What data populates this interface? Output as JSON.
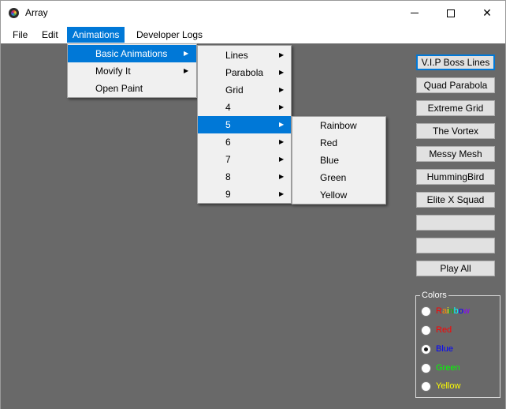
{
  "window": {
    "title": "Array",
    "minimize_icon": "minimize-icon",
    "maximize_icon": "maximize-icon",
    "close_icon": "close-icon",
    "close_glyph": "✕"
  },
  "menubar": {
    "items": [
      {
        "label": "File"
      },
      {
        "label": "Edit"
      },
      {
        "label": "Animations",
        "active": true
      },
      {
        "label": "Developer Logs"
      }
    ]
  },
  "menus": {
    "animations": [
      {
        "label": "Basic Animations",
        "has_submenu": true,
        "highlighted": true
      },
      {
        "label": "Movify It",
        "has_submenu": true
      },
      {
        "label": "Open Paint",
        "has_submenu": false
      }
    ],
    "basic_animations": [
      {
        "label": "Lines",
        "has_submenu": true
      },
      {
        "label": "Parabola",
        "has_submenu": true
      },
      {
        "label": "Grid",
        "has_submenu": true
      },
      {
        "label": "4",
        "has_submenu": true
      },
      {
        "label": "5",
        "has_submenu": true,
        "highlighted": true
      },
      {
        "label": "6",
        "has_submenu": true
      },
      {
        "label": "7",
        "has_submenu": true
      },
      {
        "label": "8",
        "has_submenu": true
      },
      {
        "label": "9",
        "has_submenu": true
      }
    ],
    "submenu_5": [
      {
        "label": "Rainbow"
      },
      {
        "label": "Red"
      },
      {
        "label": "Blue"
      },
      {
        "label": "Green"
      },
      {
        "label": "Yellow"
      }
    ],
    "arrow_glyph": "▶"
  },
  "buttons": [
    {
      "label": "V.I.P Boss Lines",
      "focused": true
    },
    {
      "label": "Quad Parabola"
    },
    {
      "label": "Extreme Grid"
    },
    {
      "label": "The Vortex"
    },
    {
      "label": "Messy Mesh"
    },
    {
      "label": "HummingBird"
    },
    {
      "label": "Elite X Squad"
    },
    {
      "label": ""
    },
    {
      "label": ""
    },
    {
      "label": "Play All"
    }
  ],
  "colors_group": {
    "legend": "Colors",
    "options": [
      {
        "label": "Rainbow",
        "color": "rainbow",
        "checked": false
      },
      {
        "label": "Red",
        "color": "#ff0000",
        "checked": false
      },
      {
        "label": "Blue",
        "color": "#0000ff",
        "checked": true
      },
      {
        "label": "Green",
        "color": "#00ff00",
        "checked": false
      },
      {
        "label": "Yellow",
        "color": "#ffff00",
        "checked": false
      }
    ],
    "rainbow_colors": [
      "#ff0000",
      "#ff8c00",
      "#ffff00",
      "#00c000",
      "#00ffff",
      "#0000ff",
      "#8b00ff"
    ]
  },
  "theme": {
    "accent": "#0078d7",
    "client_bg": "#696969",
    "menu_bg": "#f0f0f0"
  }
}
